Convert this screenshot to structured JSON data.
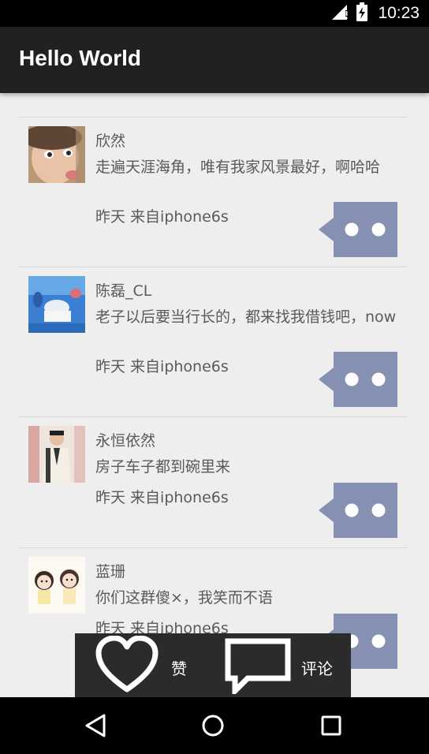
{
  "status_bar": {
    "time": "10:23",
    "icons": [
      "signal-icon",
      "battery-icon"
    ]
  },
  "app_bar": {
    "title": "Hello World"
  },
  "feed": {
    "items": [
      {
        "name": "欣然",
        "content": "走遍天涯海角，唯有我家风景最好，啊哈哈",
        "meta": "昨天 来自iphone6s",
        "avatar": "child-photo"
      },
      {
        "name": "陈磊_CL",
        "content": "老子以后要当行长的，都来找我借钱吧，now",
        "meta": "昨天 来自iphone6s",
        "avatar": "underwater-photo"
      },
      {
        "name": "永恒依然",
        "content": "房子车子都到碗里来",
        "meta": "昨天 来自iphone6s",
        "avatar": "man-in-suit-photo"
      },
      {
        "name": "蓝珊",
        "content": "你们这群傻×，我笑而不语",
        "meta": "昨天 来自iphone6s",
        "avatar": "cartoon-girls-drawing"
      }
    ]
  },
  "action_popup": {
    "like_label": "赞",
    "comment_label": "评论"
  },
  "nav_bar": {
    "buttons": [
      "back-icon",
      "home-icon",
      "recents-icon"
    ]
  },
  "colors": {
    "app_bar": "#212121",
    "background": "#eeeeee",
    "comment_button": "#8590b3",
    "text": "#5a5a5a",
    "popup": "#2b2b2b"
  }
}
